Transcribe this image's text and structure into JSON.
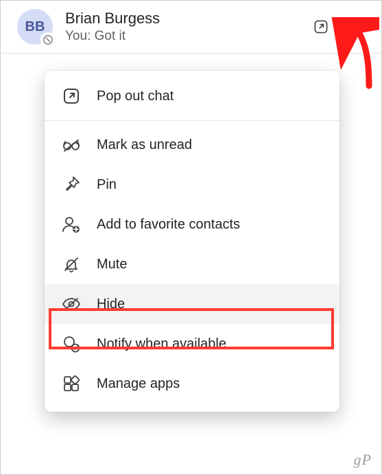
{
  "chat": {
    "avatar_initials": "BB",
    "name": "Brian Burgess",
    "preview": "You: Got it"
  },
  "menu": {
    "popout": "Pop out chat",
    "mark_unread": "Mark as unread",
    "pin": "Pin",
    "add_favorite": "Add to favorite contacts",
    "mute": "Mute",
    "hide": "Hide",
    "notify": "Notify when available",
    "manage_apps": "Manage apps"
  },
  "watermark": "gP"
}
